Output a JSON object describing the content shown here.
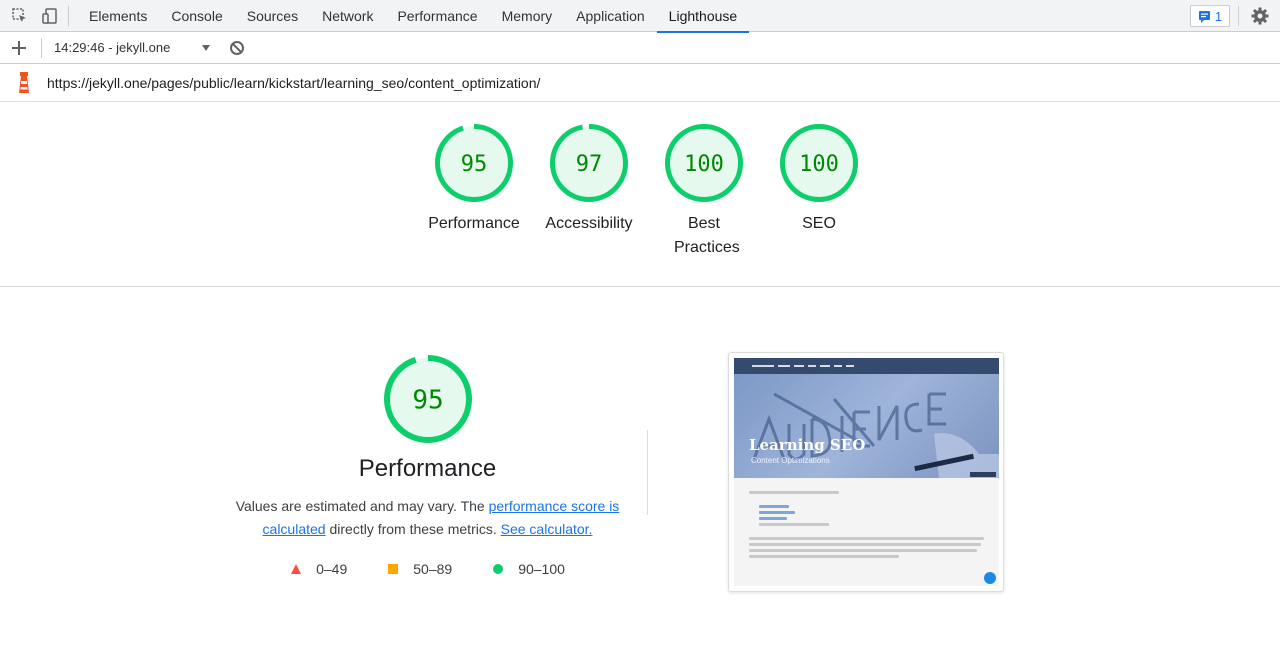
{
  "devtools": {
    "tabs": [
      "Elements",
      "Console",
      "Sources",
      "Network",
      "Performance",
      "Memory",
      "Application",
      "Lighthouse"
    ],
    "active_tab": "Lighthouse",
    "issues_count": "1",
    "icons": {
      "inspect": "inspect-element-icon",
      "device": "device-toggle-icon",
      "issues": "issues-icon",
      "settings": "gear-icon"
    }
  },
  "toolbar": {
    "add_icon": "plus-icon",
    "report_selector": "14:29:46 - jekyll.one",
    "dropdown_icon": "chevron-down-icon",
    "clear_icon": "block-icon"
  },
  "report": {
    "url": "https://jekyll.one/pages/public/learn/kickstart/learning_seo/content_optimization/",
    "lighthouse_icon": "lighthouse-icon"
  },
  "scores": [
    {
      "value": "95",
      "label": "Performance",
      "fraction": 0.95
    },
    {
      "value": "97",
      "label": "Accessibility",
      "fraction": 0.97
    },
    {
      "value": "100",
      "label": "Best Practices",
      "fraction": 1.0
    },
    {
      "value": "100",
      "label": "SEO",
      "fraction": 1.0
    }
  ],
  "performance": {
    "score": "95",
    "fraction": 0.95,
    "title": "Performance",
    "desc_prefix": "Values are estimated and may vary. The ",
    "link1": "performance score is calculated",
    "desc_middle": " directly from these metrics. ",
    "link2": "See calculator."
  },
  "legend": [
    {
      "range": "0–49",
      "color": "#ff4e42",
      "shape": "triangle"
    },
    {
      "range": "50–89",
      "color": "#ffa400",
      "shape": "square"
    },
    {
      "range": "90–100",
      "color": "#0cce6b",
      "shape": "circle"
    }
  ],
  "colors": {
    "pass": "#0cce6b",
    "pass_text": "#008800",
    "pass_fill": "#e6f9ef",
    "link": "#1a73e8"
  },
  "screenshot": {
    "hero_title": "Learning SEO",
    "hero_subtitle": "Content Optimizations"
  }
}
